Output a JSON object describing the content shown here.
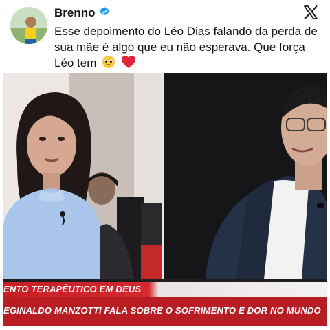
{
  "tweet": {
    "author_name": "Brenno",
    "text": "Esse depoimento do Léo Dias falando da perda de sua mãe é algo que eu não esperava. Que força Léo tem",
    "emojis": [
      "pleading-face-emoji",
      "red-heart-emoji"
    ]
  },
  "video": {
    "ticker_top": "ENTO TERAPÊUTICO EM DEUS",
    "ticker_bottom": "EGINALDO MANZOTTI FALA SOBRE O SOFRIMENTO E DOR NO MUNDO"
  },
  "colors": {
    "verified_badge": "#1d9bf0",
    "ticker_red": "#b81d24",
    "text_primary": "#0f1419"
  }
}
